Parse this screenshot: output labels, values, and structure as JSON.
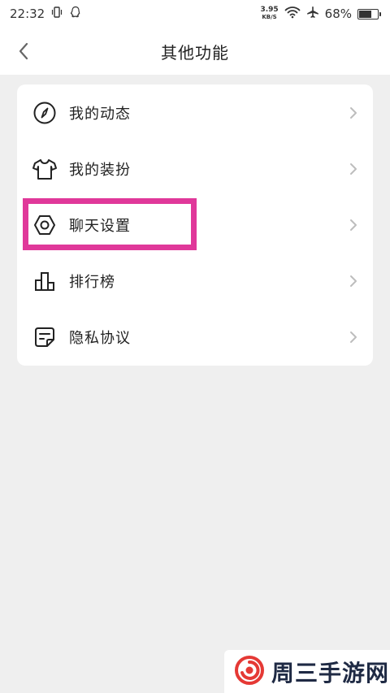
{
  "status_bar": {
    "time": "22:32",
    "net_speed_value": "3.95",
    "net_speed_unit": "KB/S",
    "battery_percent": "68%",
    "battery_level": 0.68
  },
  "header": {
    "title": "其他功能"
  },
  "menu": {
    "items": [
      {
        "label": "我的动态",
        "icon": "compass-icon"
      },
      {
        "label": "我的装扮",
        "icon": "tshirt-icon"
      },
      {
        "label": "聊天设置",
        "icon": "hex-nut-settings-icon"
      },
      {
        "label": "排行榜",
        "icon": "ranking-bars-icon"
      },
      {
        "label": "隐私协议",
        "icon": "document-note-icon"
      }
    ]
  },
  "watermark": {
    "text": "周三手游网"
  },
  "colors": {
    "background": "#efefef",
    "card": "#ffffff",
    "highlight": "#e0389a",
    "chevron": "#bdbdbd",
    "watermark_red": "#e53935"
  }
}
